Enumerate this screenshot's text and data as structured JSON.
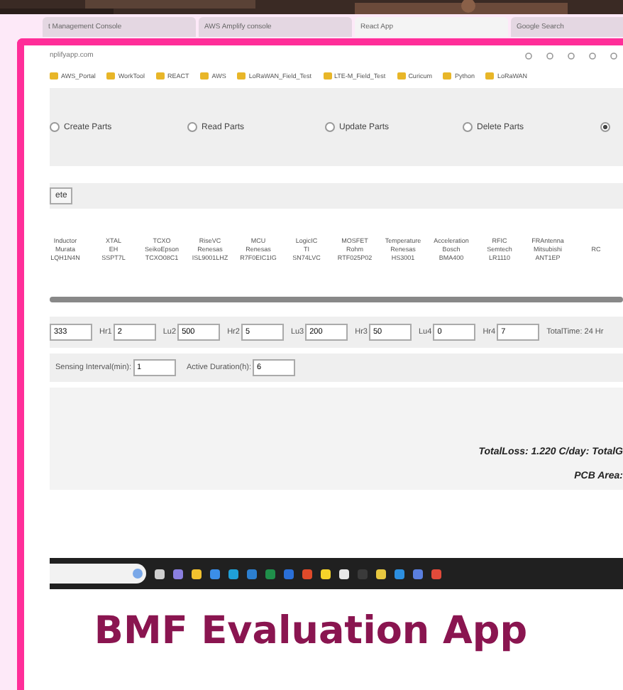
{
  "browser_tabs": [
    {
      "title": "t Management Console",
      "selected": false
    },
    {
      "title": "AWS Amplify console",
      "selected": false
    },
    {
      "title": "React App",
      "selected": true
    },
    {
      "title": "Google Search",
      "selected": false
    }
  ],
  "address": "nplifyapp.com",
  "bookmarks": [
    "AWS_Portal",
    "WorkTool",
    "REACT",
    "AWS",
    "LoRaWAN_Field_Test",
    "LTE-M_Field_Test",
    "Curicum",
    "Python",
    "LoRaWAN"
  ],
  "operations": [
    {
      "label": "Create Parts",
      "selected": false
    },
    {
      "label": "Read Parts",
      "selected": false
    },
    {
      "label": "Update Parts",
      "selected": false
    },
    {
      "label": "Delete Parts",
      "selected": false
    },
    {
      "selected": true
    }
  ],
  "action_button": "ete",
  "parts_columns": [
    [
      "Inductor",
      "Murata",
      "LQH1N4N"
    ],
    [
      "XTAL",
      "EH",
      "SSPT7L"
    ],
    [
      "TCXO",
      "SeikoEpson",
      "TCXO08C1"
    ],
    [
      "RiseVC",
      "Renesas",
      "ISL9001LHZ"
    ],
    [
      "MCU",
      "Renesas",
      "R7F0EIC1IG"
    ],
    [
      "LogicIC",
      "TI",
      "SN74LVC"
    ],
    [
      "MOSFET",
      "Rohm",
      "RTF025P02"
    ],
    [
      "Temperature",
      "Renesas",
      "HS3001"
    ],
    [
      "Acceleration",
      "Bosch",
      "BMA400"
    ],
    [
      "RFIC",
      "Semtech",
      "LR1110"
    ],
    [
      "FRAntenna",
      "Mitsubishi",
      "ANT1EP"
    ],
    [
      "RC"
    ]
  ],
  "schedule": [
    {
      "value": "333"
    },
    {
      "label": "Hr1",
      "value": "2"
    },
    {
      "label": "Lu2",
      "value": "500"
    },
    {
      "label": "Hr2",
      "value": "5"
    },
    {
      "label": "Lu3",
      "value": "200"
    },
    {
      "label": "Hr3",
      "value": "50"
    },
    {
      "label": "Lu4",
      "value": "0"
    },
    {
      "label": "Hr4",
      "value": "7"
    }
  ],
  "total_time": "TotalTime: 24 Hr",
  "sensing": [
    {
      "label": "Sensing Interval(min):",
      "value": "1"
    },
    {
      "label": "Active Duration(h):",
      "value": "6"
    }
  ],
  "results": [
    "TotalLoss: 1.220 C/day:  TotalG",
    "PCB Area:"
  ],
  "slide_title": "BMF Evaluation App"
}
